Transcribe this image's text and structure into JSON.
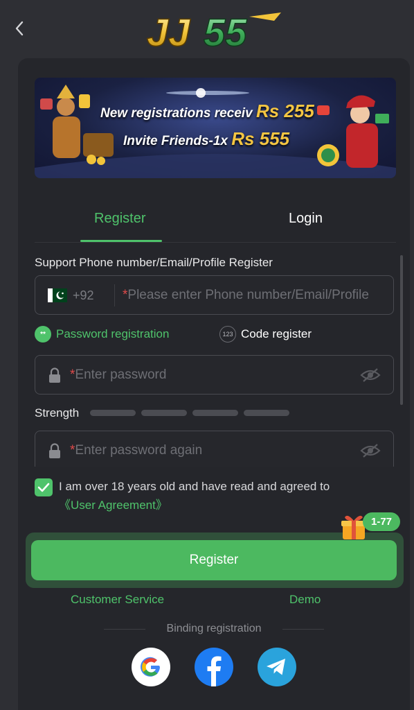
{
  "header": {
    "back_icon": "chevron-left-icon",
    "logo_text": "JJ55"
  },
  "banner": {
    "line1_text": "New registrations receiv",
    "line1_amount": "Rs 255",
    "line2_text": "Invite Friends-1x",
    "line2_amount": "Rs 555"
  },
  "tabs": [
    {
      "label": "Register",
      "active": true
    },
    {
      "label": "Login",
      "active": false
    }
  ],
  "form": {
    "support_label": "Support Phone number/Email/Profile Register",
    "country_code": "+92",
    "flag_icon": "pakistan-flag-icon",
    "phone_placeholder": "Please enter Phone number/Email/Profile",
    "required_mark": "*",
    "modes": [
      {
        "label": "Password registration",
        "icon_text": "**",
        "selected": true
      },
      {
        "label": "Code register",
        "icon_text": "123",
        "selected": false
      }
    ],
    "password_placeholder": "Enter password",
    "password_again_placeholder": "Enter password again",
    "strength_label": "Strength",
    "strength_level": 0,
    "agree_text": "I am over 18 years old and have read and agreed to",
    "agree_link": "《User Agreement》",
    "agree_checked": true
  },
  "gift_badge": "1-77",
  "register_button": "Register",
  "links": {
    "customer_service": "Customer Service",
    "demo": "Demo"
  },
  "binding_label": "Binding registration",
  "social": [
    "google-icon",
    "facebook-icon",
    "telegram-icon"
  ],
  "colors": {
    "accent": "#4fc36b",
    "background": "#2e2f34",
    "card": "#25262b",
    "button": "#4cb960"
  }
}
